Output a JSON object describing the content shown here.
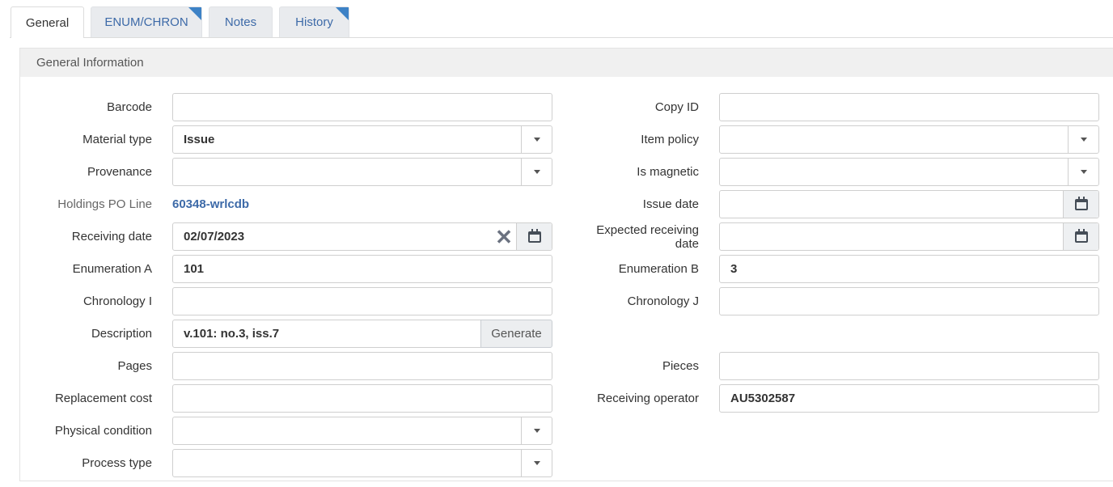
{
  "tabs": [
    {
      "label": "General",
      "active": true
    },
    {
      "label": "ENUM/CHRON",
      "active": false
    },
    {
      "label": "Notes",
      "active": false
    },
    {
      "label": "History",
      "active": false
    }
  ],
  "panel": {
    "title": "General Information"
  },
  "left": {
    "barcode": {
      "label": "Barcode",
      "value": ""
    },
    "material_type": {
      "label": "Material type",
      "value": "Issue"
    },
    "provenance": {
      "label": "Provenance",
      "value": ""
    },
    "holdings_po_line": {
      "label": "Holdings PO Line",
      "value": "60348-wrlcdb"
    },
    "receiving_date": {
      "label": "Receiving date",
      "value": "02/07/2023"
    },
    "enumeration_a": {
      "label": "Enumeration A",
      "value": "101"
    },
    "chronology_i": {
      "label": "Chronology I",
      "value": ""
    },
    "description": {
      "label": "Description",
      "value": "v.101: no.3, iss.7",
      "button": "Generate"
    },
    "pages": {
      "label": "Pages",
      "value": ""
    },
    "replacement_cost": {
      "label": "Replacement cost",
      "value": ""
    },
    "physical_condition": {
      "label": "Physical condition",
      "value": ""
    },
    "process_type": {
      "label": "Process type",
      "value": ""
    }
  },
  "right": {
    "copy_id": {
      "label": "Copy ID",
      "value": ""
    },
    "item_policy": {
      "label": "Item policy",
      "value": ""
    },
    "is_magnetic": {
      "label": "Is magnetic",
      "value": ""
    },
    "issue_date": {
      "label": "Issue date",
      "value": ""
    },
    "expected_receiving_date": {
      "label_line1": "Expected receiving",
      "label_line2": "date",
      "value": ""
    },
    "enumeration_b": {
      "label": "Enumeration B",
      "value": "3"
    },
    "chronology_j": {
      "label": "Chronology J",
      "value": ""
    },
    "pieces": {
      "label": "Pieces",
      "value": ""
    },
    "receiving_operator": {
      "label": "Receiving operator",
      "value": "AU5302587"
    }
  },
  "icons": {
    "dropdown": "chevron-down-icon",
    "calendar": "calendar-icon",
    "clear": "close-icon",
    "tab_marker": "corner-flag-icon"
  },
  "colors": {
    "link": "#3d6aa8",
    "tab_marker": "#3d82c6",
    "header_bg": "#f0f0f0"
  }
}
